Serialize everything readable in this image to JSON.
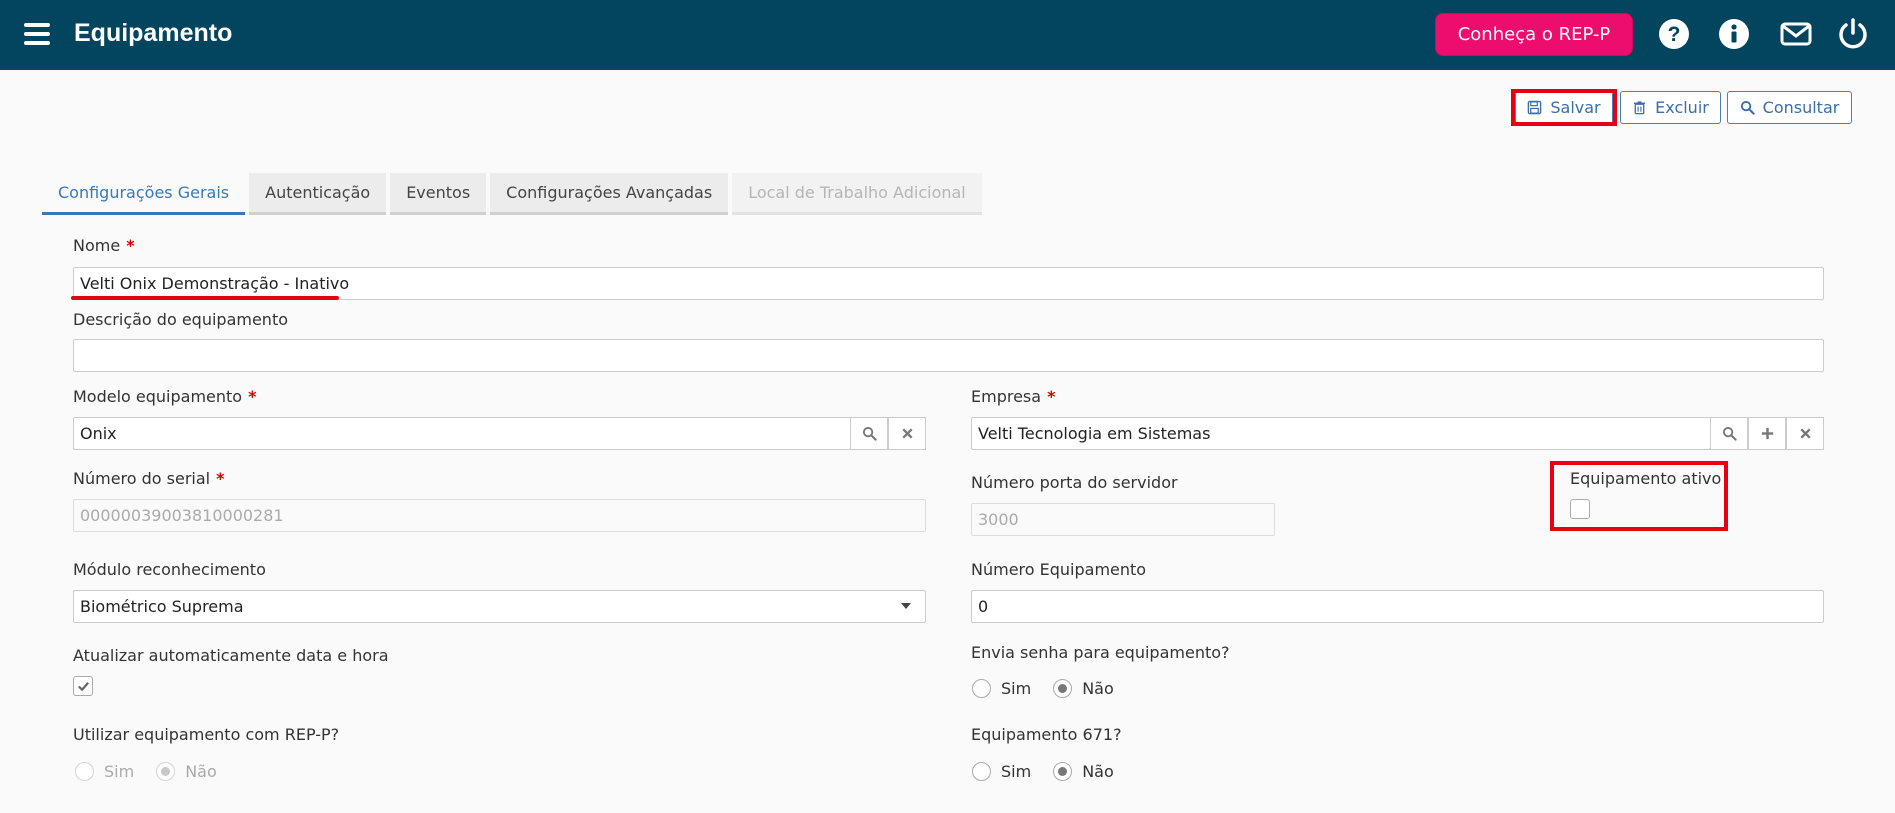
{
  "header": {
    "title": "Equipamento",
    "rep_button": "Conheça o REP-P",
    "icons": [
      "help-icon",
      "info-icon",
      "mail-icon",
      "power-icon"
    ],
    "background": "#03445e",
    "accent": "#ec0d6e"
  },
  "toolbar": {
    "save_label": "Salvar",
    "delete_label": "Excluir",
    "search_label": "Consultar"
  },
  "tabs": [
    {
      "label": "Configurações Gerais",
      "state": "active"
    },
    {
      "label": "Autenticação",
      "state": "normal"
    },
    {
      "label": "Eventos",
      "state": "normal"
    },
    {
      "label": "Configurações Avançadas",
      "state": "normal"
    },
    {
      "label": "Local de Trabalho Adicional",
      "state": "disabled"
    }
  ],
  "form": {
    "nome": {
      "label": "Nome",
      "value": "Velti Onix Demonstração - Inativo",
      "required": "*"
    },
    "descricao": {
      "label": "Descrição do equipamento",
      "value": ""
    },
    "modelo": {
      "label": "Modelo equipamento",
      "value": "Onix",
      "required": "*"
    },
    "empresa": {
      "label": "Empresa",
      "value": "Velti Tecnologia em Sistemas",
      "required": "*"
    },
    "serial": {
      "label": "Número do serial",
      "value": "00000039003810000281",
      "required": "*"
    },
    "porta": {
      "label": "Número porta do servidor",
      "value": "3000"
    },
    "ativo": {
      "label": "Equipamento ativo",
      "checked": false
    },
    "modulo": {
      "label": "Módulo reconhecimento",
      "value": "Biométrico Suprema"
    },
    "numero_equipamento": {
      "label": "Número Equipamento",
      "value": "0"
    },
    "atualizar": {
      "label": "Atualizar automaticamente data e hora",
      "checked": true
    },
    "envia_senha": {
      "label": "Envia senha para equipamento?",
      "options": [
        "Sim",
        "Não"
      ],
      "selected": "Não"
    },
    "rep_p": {
      "label": "Utilizar equipamento com REP-P?",
      "options": [
        "Sim",
        "Não"
      ],
      "selected": "Não",
      "disabled": true
    },
    "equip_671": {
      "label": "Equipamento 671?",
      "options": [
        "Sim",
        "Não"
      ],
      "selected": "Não"
    }
  },
  "highlight_color": "#e60012"
}
